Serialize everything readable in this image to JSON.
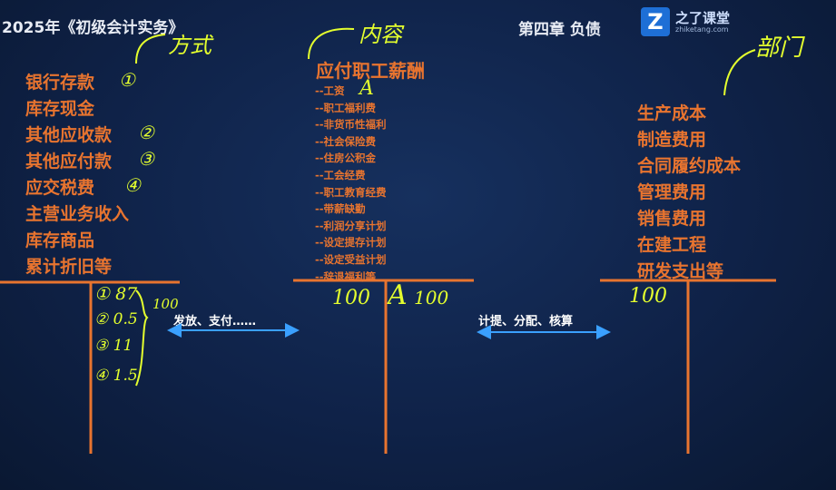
{
  "header": {
    "course_title": "2025年《初级会计实务》",
    "chapter": "第四章  负债",
    "logo_icon_letter": "Z",
    "logo_name": "之了课堂",
    "logo_url": "zhiketang.com"
  },
  "left_column": {
    "items": [
      "银行存款",
      "库存现金",
      "其他应收款",
      "其他应付款",
      "应交税费",
      "主营业务收入",
      "库存商品",
      "累计折旧等"
    ],
    "annotation": "方式",
    "circled_numbers": [
      "①",
      "②",
      "③",
      "④"
    ],
    "ledger_values": [
      "① 87",
      "② 0.5",
      "③ 11",
      "④ 1.5"
    ],
    "ledger_total": "100"
  },
  "center_column": {
    "title": "应付职工薪酬",
    "annotation": "内容",
    "marker": "A",
    "items": [
      "--工资",
      "--职工福利费",
      "--非货币性福利",
      "--社会保险费",
      "--住房公积金",
      "--工会经费",
      "--职工教育经费",
      "--带薪缺勤",
      "--利润分享计划",
      "--设定提存计划",
      "--设定受益计划",
      "--辞退福利等"
    ],
    "ledger_left": "100",
    "ledger_marker": "A",
    "ledger_right": "100"
  },
  "right_column": {
    "items": [
      "生产成本",
      "制造费用",
      "合同履约成本",
      "管理费用",
      "销售费用",
      "在建工程",
      "研发支出等"
    ],
    "annotation": "部门",
    "ledger_value": "100"
  },
  "arrows": {
    "left_label": "发放、支付……",
    "right_label": "计提、分配、核算"
  },
  "colors": {
    "background": "#0f2248",
    "accent_text": "#e8742f",
    "handwriting": "#e4ff2e",
    "arrow": "#3aa0ff",
    "ledger_line": "#e8742f"
  }
}
